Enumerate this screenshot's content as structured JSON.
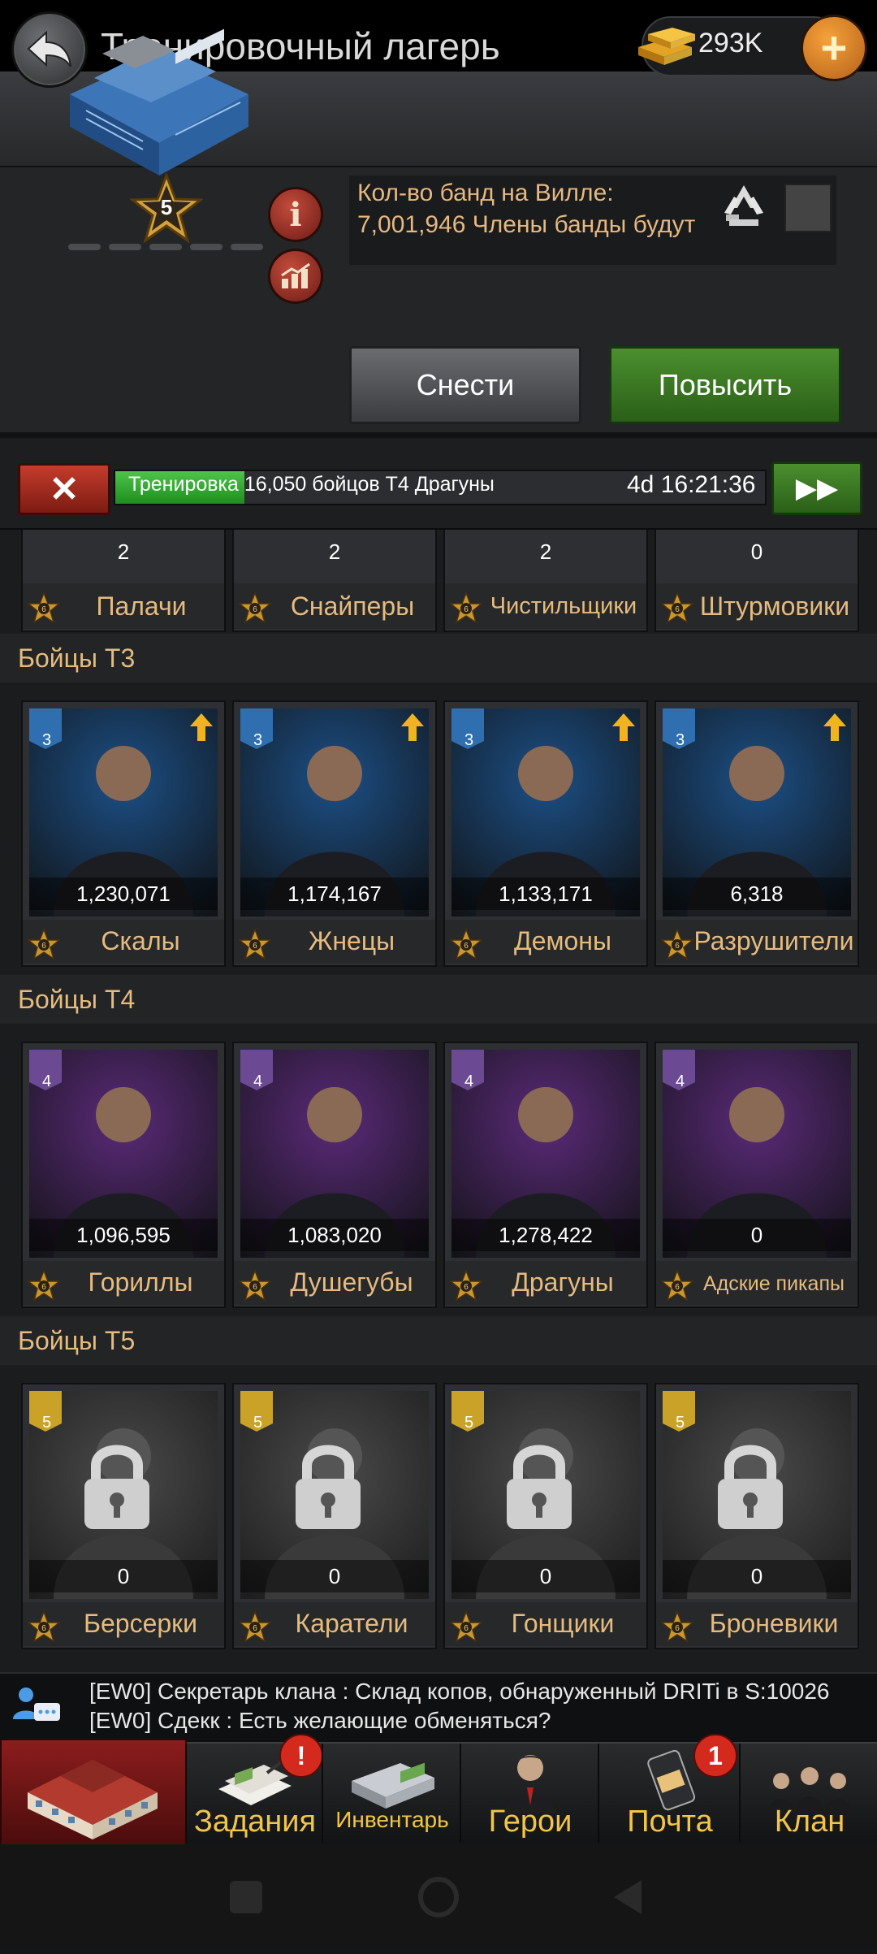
{
  "header": {
    "title": "Тренировочный лагерь",
    "gold_amount": "293K"
  },
  "building": {
    "level": "5",
    "description": "Кол-во банд на Вилле: 7,001,946 Члены банды будут",
    "demolish_label": "Снести",
    "upgrade_label": "Повысить"
  },
  "training": {
    "text_part1": "Тренировка 16,050",
    "text_part2": " бойцов Т4 Драгуны",
    "timer": "4d 16:21:36",
    "progress": 0.2
  },
  "partial_row": [
    {
      "count": "2",
      "name": "Палачи"
    },
    {
      "count": "2",
      "name": "Снайперы"
    },
    {
      "count": "2",
      "name": "Чистильщики"
    },
    {
      "count": "0",
      "name": "Штурмовики"
    }
  ],
  "sections": [
    {
      "title": "Бойцы Т3",
      "tier": "3",
      "theme": "#1c4f85",
      "troops": [
        {
          "count": "1,230,071",
          "name": "Скалы",
          "upgrade": true
        },
        {
          "count": "1,174,167",
          "name": "Жнецы",
          "upgrade": true
        },
        {
          "count": "1,133,171",
          "name": "Демоны",
          "upgrade": true
        },
        {
          "count": "6,318",
          "name": "Разрушители",
          "upgrade": true
        }
      ]
    },
    {
      "title": "Бойцы Т4",
      "tier": "4",
      "theme": "#5a2a78",
      "troops": [
        {
          "count": "1,096,595",
          "name": "Гориллы"
        },
        {
          "count": "1,083,020",
          "name": "Душегубы"
        },
        {
          "count": "1,278,422",
          "name": "Драгуны"
        },
        {
          "count": "0",
          "name": "Адские пикапы"
        }
      ]
    },
    {
      "title": "Бойцы Т5",
      "tier": "5",
      "theme": "#333333",
      "locked": true,
      "troops": [
        {
          "count": "0",
          "name": "Берсерки"
        },
        {
          "count": "0",
          "name": "Каратели"
        },
        {
          "count": "0",
          "name": "Гонщики"
        },
        {
          "count": "0",
          "name": "Броневики"
        }
      ]
    }
  ],
  "chat": {
    "line1": "[EW0] Секретарь клана : Склад копов, обнаруженный DRITi в S:10026",
    "line2": "[EW0] Сдекк : Есть желающие обменяться?"
  },
  "nav": {
    "tasks": "Задания",
    "inventory": "Инвентарь",
    "heroes": "Герои",
    "mail": "Почта",
    "mail_badge": "1",
    "clan": "Клан",
    "tasks_badge": "!"
  },
  "colors": {
    "accent_gold": "#e5bb7f",
    "button_green": "#3d7a26",
    "button_red": "#a22a1e"
  }
}
